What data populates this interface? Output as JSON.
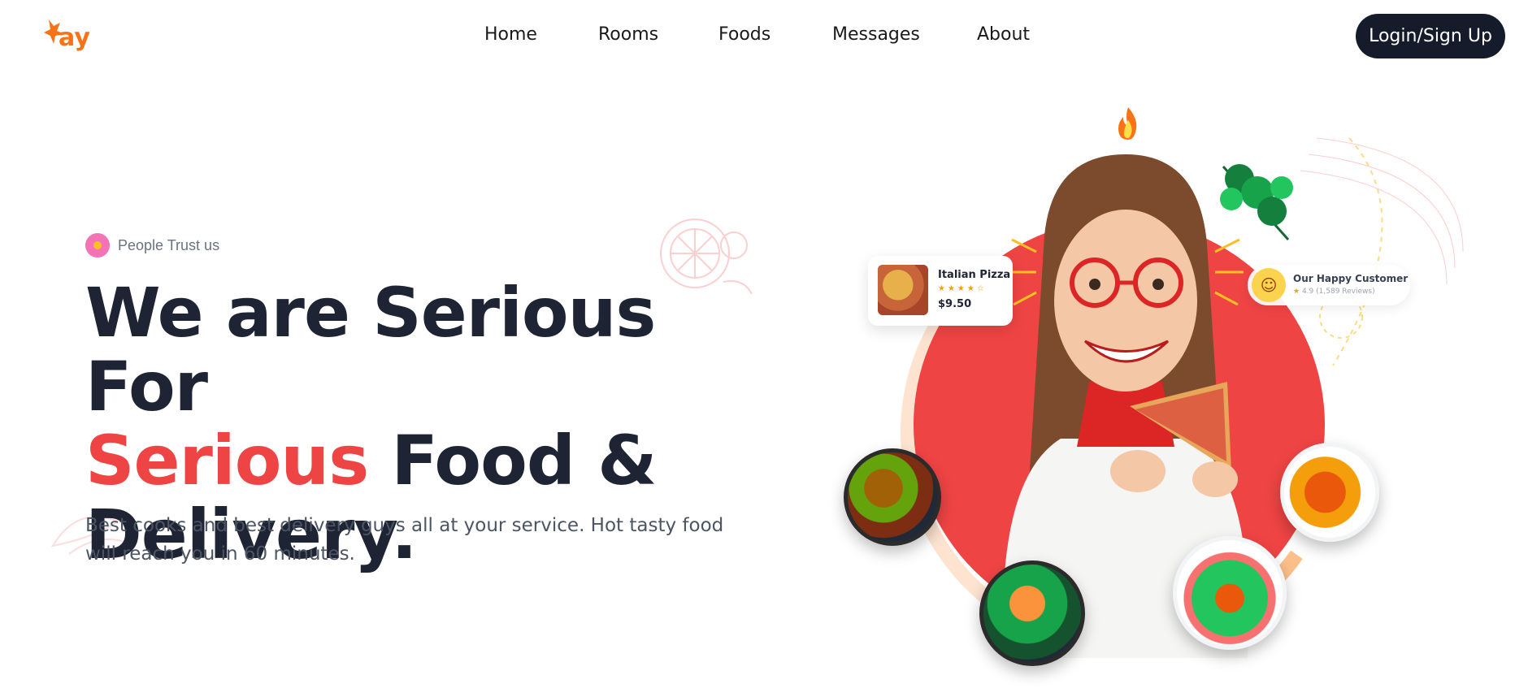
{
  "brand": {
    "logo_text": "tay",
    "accent_color": "#f97316"
  },
  "nav": {
    "items": [
      {
        "label": "Home"
      },
      {
        "label": "Rooms"
      },
      {
        "label": "Foods"
      },
      {
        "label": "Messages"
      },
      {
        "label": "About"
      }
    ],
    "login_label": "Login/Sign Up"
  },
  "hero": {
    "badge_text": "People Trust us",
    "headline_line1": "We are Serious For",
    "headline_accent": "Serious",
    "headline_line2_rest": " Food &",
    "headline_line3": "Delivery.",
    "subtext": "Best cooks and best delivery guys all at your service. Hot tasty food will reach you in 60 minutes.",
    "accent_color": "#ef4444",
    "dark_color": "#1e2433"
  },
  "cards": {
    "pizza": {
      "title": "Italian Pizza",
      "stars": "★★★★☆",
      "price": "$9.50"
    },
    "customer": {
      "title": "Our Happy Customer",
      "rating": "4.9",
      "reviews": "(1,589 Reviews)"
    }
  },
  "icons": {
    "badge": "heart-badge-icon",
    "flame": "flame-icon",
    "cilantro": "cilantro-leaf-icon",
    "smile": "smile-face-icon"
  }
}
